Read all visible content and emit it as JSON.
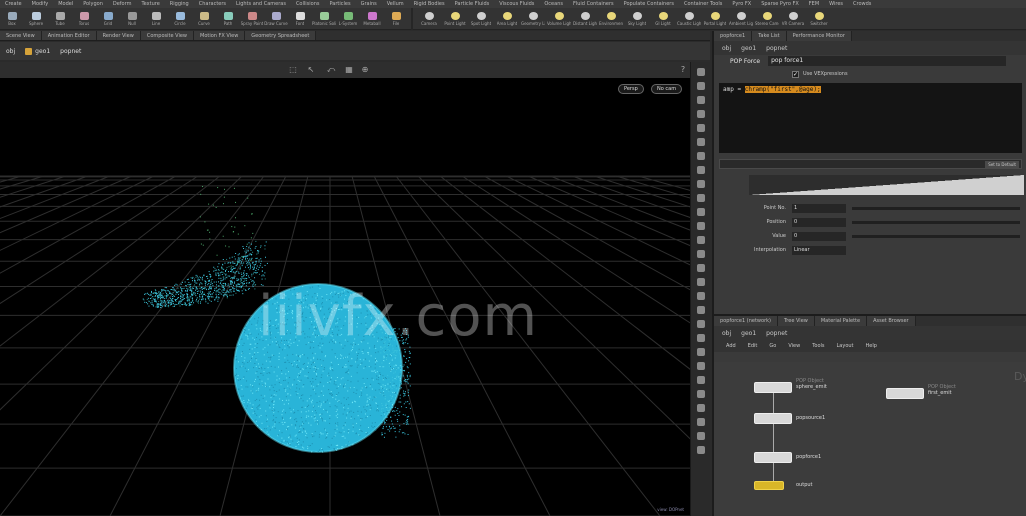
{
  "shelf": {
    "tabs": [
      "Create",
      "Modify",
      "Model",
      "Polygon",
      "Deform",
      "Texture",
      "Rigging",
      "Characters",
      "Lights and Cameras",
      "Collisions",
      "Particles",
      "Grains",
      "Vellum",
      "Rigid Bodies",
      "Particle Fluids",
      "Viscous Fluids",
      "Oceans",
      "Fluid Containers",
      "Populate Containers",
      "Container Tools",
      "Pyro FX",
      "Sparse Pyro FX",
      "FEM",
      "Wires",
      "Crowds"
    ],
    "tools": [
      "Box",
      "Sphere",
      "Tube",
      "Torus",
      "Grid",
      "Null",
      "Line",
      "Circle",
      "Curve",
      "Path",
      "Spray Paint",
      "Draw Curve",
      "Font",
      "Platonic Solids",
      "L-System",
      "Metaball",
      "File"
    ],
    "light_tools": [
      "Camera",
      "Point Light",
      "Spot Light",
      "Area Light",
      "Geometry Light",
      "Volume Light",
      "Distant Light",
      "Environment Light",
      "Sky Light",
      "GI Light",
      "Caustic Light",
      "Portal Light",
      "Ambient Light",
      "Stereo Camera",
      "VR Camera",
      "Switcher"
    ]
  },
  "viewer": {
    "tabs": [
      "Scene View",
      "Animation Editor",
      "Render View",
      "Composite View",
      "Motion FX View",
      "Geometry Spreadsheet"
    ],
    "path": [
      "obj",
      "geo1",
      "popnet"
    ],
    "persp_label": "Persp",
    "cam_label": "No cam",
    "status": "view: DOPnet"
  },
  "params": {
    "tabs": [
      "popforce1",
      "Take List",
      "Performance Monitor"
    ],
    "path": [
      "obj",
      "geo1",
      "popnet"
    ],
    "node_type": "POP Force",
    "node_name": "pop force1",
    "vex_toggle_label": "Use VEXpressions",
    "code_prefix": "amp",
    "code_expression": "chramp(\"first\",@age);",
    "ramp_button": "Set to Default",
    "rows": [
      {
        "label": "Point No.",
        "value": "1"
      },
      {
        "label": "Position",
        "value": "0"
      },
      {
        "label": "Value",
        "value": "0"
      },
      {
        "label": "Interpolation",
        "value": "Linear"
      }
    ]
  },
  "network": {
    "tabs": [
      "popforce1 (network)",
      "Tree View",
      "Material Palette",
      "Asset Browser"
    ],
    "path": [
      "obj",
      "geo1",
      "popnet"
    ],
    "menu": [
      "Add",
      "Edit",
      "Go",
      "View",
      "Tools",
      "Layout",
      "Help"
    ],
    "nodes": [
      {
        "name": "sphere_emit",
        "type": "POP Object"
      },
      {
        "name": "popsource1",
        "type": "POP Source"
      },
      {
        "name": "popforce1",
        "type": "POP Force"
      },
      {
        "name": "output",
        "type": "Output"
      },
      {
        "name": "first_emit",
        "type": "POP Object"
      }
    ],
    "bg_label": "Dyn"
  },
  "watermark": "iiivfx.com"
}
